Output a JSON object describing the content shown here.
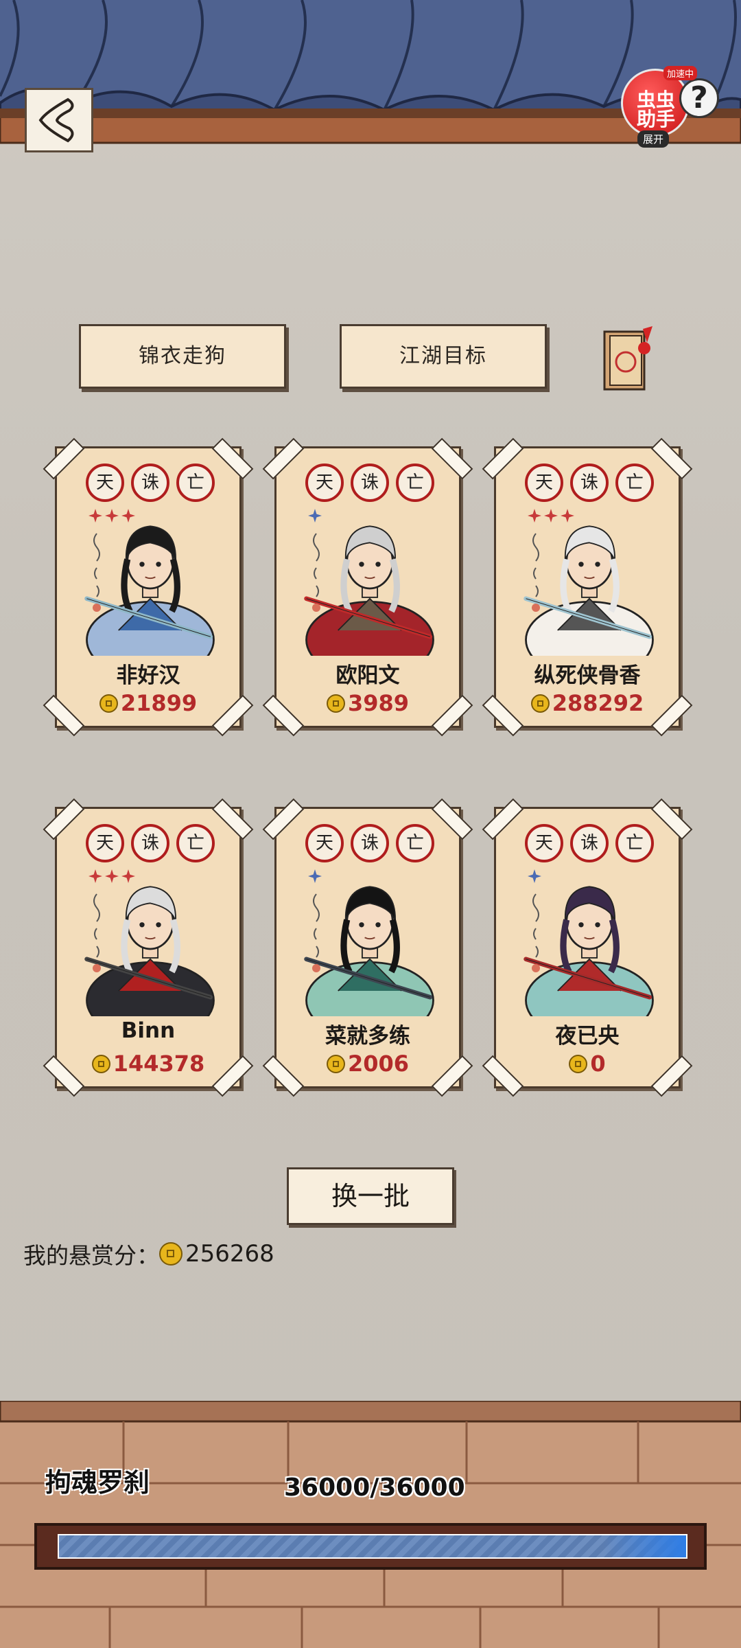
{
  "header": {
    "assistant": {
      "tag": "加速中",
      "name": "虫虫助手",
      "expand": "展开"
    },
    "help_symbol": "?"
  },
  "tabs": [
    "锦衣走狗",
    "江湖目标"
  ],
  "seals": [
    "天",
    "诛",
    "亡"
  ],
  "cards": [
    {
      "name": "非好汉",
      "bounty": "21899",
      "stars": 3,
      "star_color": "red",
      "portrait": "swordsman-blue-robe"
    },
    {
      "name": "欧阳文",
      "bounty": "3989",
      "stars": 1,
      "star_color": "blue",
      "portrait": "swordsman-red-cape"
    },
    {
      "name": "纵死侠骨香",
      "bounty": "288292",
      "stars": 3,
      "star_color": "red",
      "portrait": "swordswoman-white"
    },
    {
      "name": "Binn",
      "bounty": "144378",
      "stars": 3,
      "star_color": "red",
      "portrait": "masked-dark-warrior"
    },
    {
      "name": "菜就多练",
      "bounty": "2006",
      "stars": 1,
      "star_color": "blue",
      "portrait": "swordsman-green-broadsword"
    },
    {
      "name": "夜已央",
      "bounty": "0",
      "stars": 1,
      "star_color": "blue",
      "portrait": "swordswoman-ponytail"
    }
  ],
  "refresh_label": "换一批",
  "my_score": {
    "label": "我的悬赏分：",
    "value": "256268"
  },
  "boss": {
    "name": "拘魂罗刹",
    "hp_text": "36000/36000",
    "hp_fraction": 1.0
  },
  "colors": {
    "seal_red": "#b01d1d",
    "bounty_red": "#b32a2a",
    "roof_blue": "#4d5f8f",
    "hp_bar": "#6d8ec0"
  }
}
